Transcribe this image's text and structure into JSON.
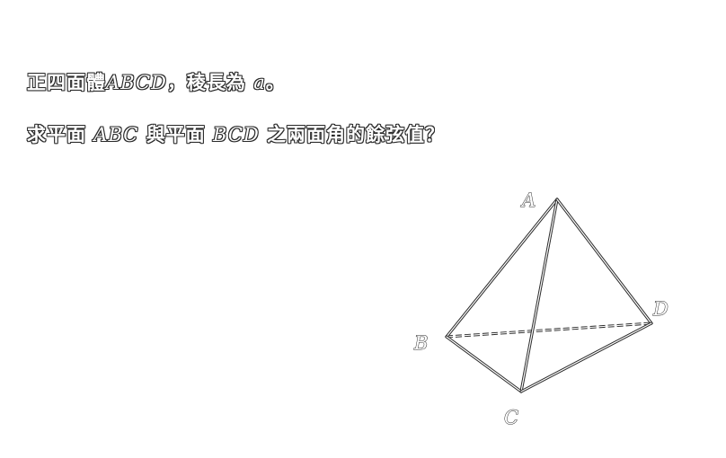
{
  "problem": {
    "line1": {
      "prefix": "正四面體",
      "shape": "ABCD",
      "middle": "，稜長為",
      "var": "a",
      "suffix": "。"
    },
    "line2": {
      "prefix": "求平面",
      "plane1": "ABC",
      "middle": "與平面",
      "plane2": "BCD",
      "suffix": "之兩面角的餘弦值？"
    }
  },
  "figure": {
    "vertices": {
      "A": "A",
      "B": "B",
      "C": "C",
      "D": "D"
    },
    "hidden_edge": "BD"
  }
}
